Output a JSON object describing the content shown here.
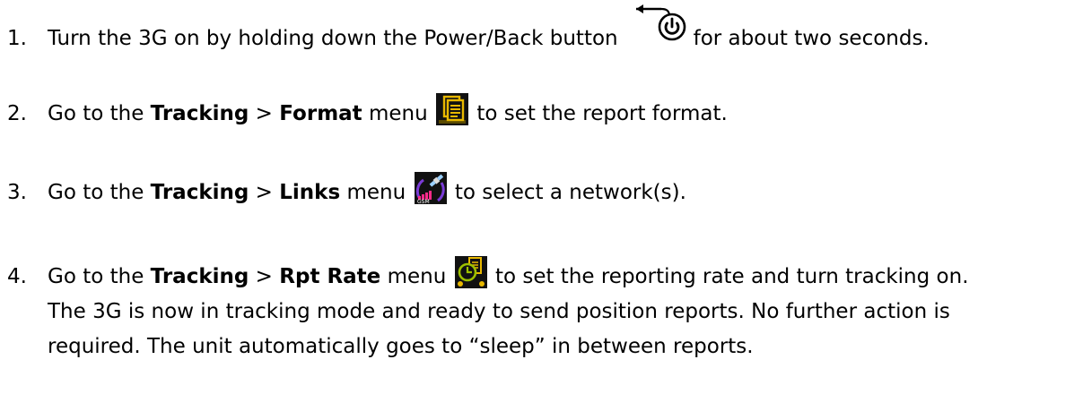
{
  "steps": [
    {
      "number": "1.",
      "parts": [
        "Turn the 3G on by holding down the Power/Back button",
        "for about two seconds."
      ],
      "icon": "power-back-icon"
    },
    {
      "number": "2.",
      "parts": [
        "Go to the",
        "Tracking",
        ">",
        "Format",
        "menu",
        "to set the report format."
      ],
      "icon": "format-icon"
    },
    {
      "number": "3.",
      "parts": [
        "Go to the",
        "Tracking",
        ">",
        "Links",
        "menu",
        "to select a network(s)."
      ],
      "icon": "links-satellite-gsm-icon"
    },
    {
      "number": "4.",
      "parts": [
        "Go to the",
        "Tracking",
        ">",
        "Rpt Rate",
        "menu",
        "to set the reporting rate and turn tracking on."
      ],
      "icon": "rpt-rate-icon",
      "continuation": [
        "The 3G is now in tracking mode and ready to send position reports. No further action is",
        "required. The unit automatically goes to “sleep” in between reports."
      ]
    }
  ],
  "colors": {
    "text": "#000000",
    "icon_dark": "#111111",
    "icon_gold": "#e8b800",
    "icon_magenta": "#ff2a8a",
    "icon_purple": "#7a3bd6"
  }
}
